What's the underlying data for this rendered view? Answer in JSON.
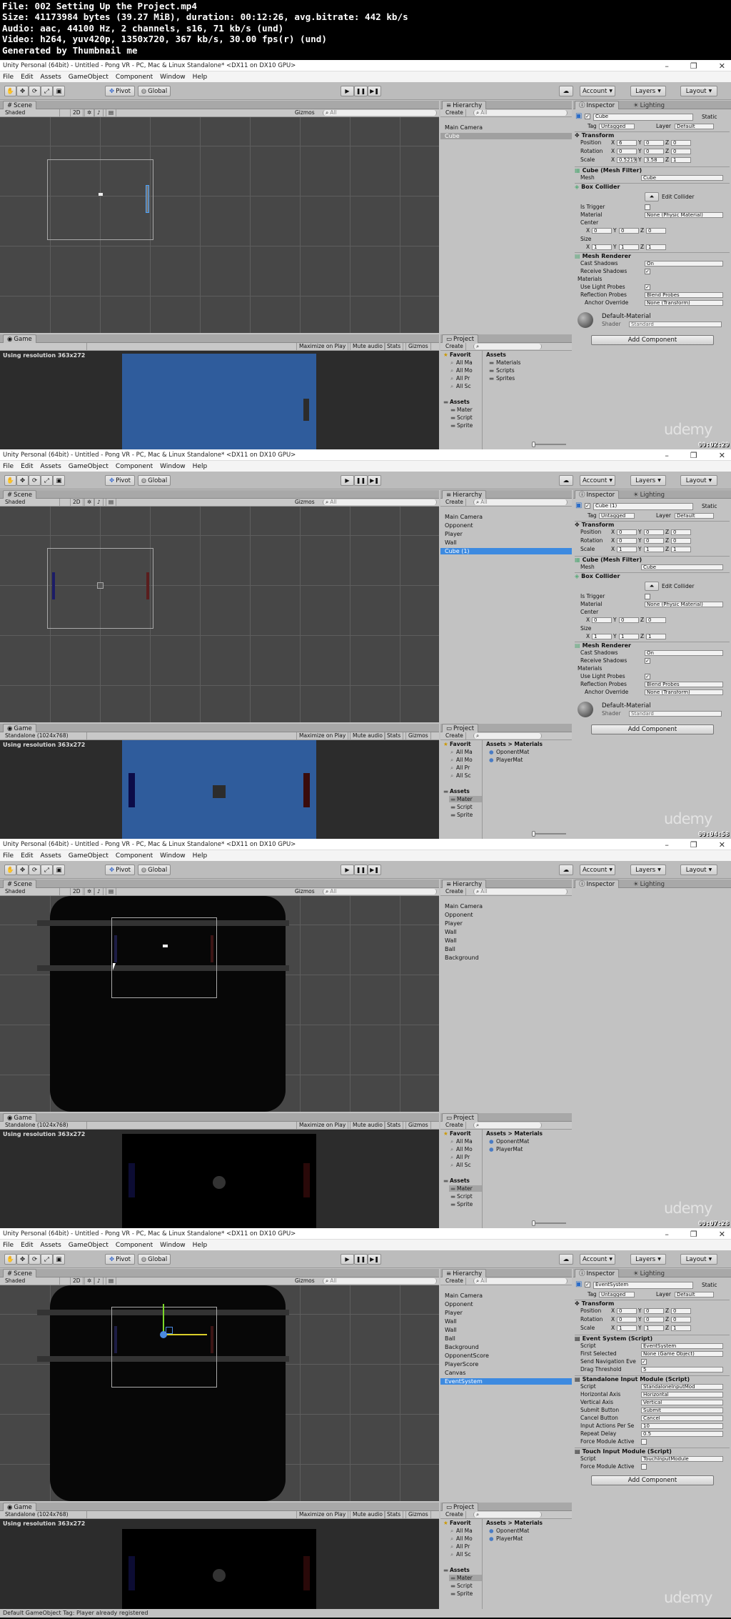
{
  "info": {
    "lines": [
      "File: 002 Setting Up the Project.mp4",
      "Size: 41173984 bytes (39.27 MiB), duration: 00:12:26, avg.bitrate: 442 kb/s",
      "Audio: aac, 44100 Hz, 2 channels, s16, 71 kb/s (und)",
      "Video: h264, yuv420p, 1350x720, 367 kb/s, 30.00 fps(r) (und)",
      "Generated by Thumbnail me"
    ]
  },
  "common": {
    "window_title": "Unity Personal (64bit) - Untitled - Pong VR - PC, Mac & Linux Standalone* <DX11 on DX10 GPU>",
    "menu": [
      "File",
      "Edit",
      "Assets",
      "GameObject",
      "Component",
      "Window",
      "Help"
    ],
    "toolbar": {
      "pivot": "Pivot",
      "global": "Global",
      "account": "Account",
      "layers": "Layers",
      "layout": "Layout"
    },
    "scene_tab": "Scene",
    "game_tab": "Game",
    "shaded": "Shaded",
    "mode_2d": "2D",
    "gizmos": "Gizmos",
    "search_all": "All",
    "maximize": "Maximize on Play",
    "mute": "Mute audio",
    "stats": "Stats",
    "hierarchy_tab": "Hierarchy",
    "create": "Create",
    "project_tab": "Project",
    "inspector_tab": "Inspector",
    "lighting_tab": "Lighting",
    "resolution_text": "Using resolution 363x272",
    "favorites": "Favorit",
    "fav_items": [
      "All Ma",
      "All Mo",
      "All Pr",
      "All Sc"
    ],
    "assets_label": "Assets",
    "asset_folders": [
      "Mater",
      "Script",
      "Sprite"
    ],
    "add_component": "Add Component",
    "watermark": "udemy",
    "static": "Static",
    "tag_label": "Tag",
    "tag_value": "Untagged",
    "layer_label": "Layer",
    "layer_value": "Default"
  },
  "frames": [
    {
      "timestamp": "00:02:29",
      "game_aspect": "",
      "hierarchy": [
        "Main Camera",
        "Cube"
      ],
      "hierarchy_selected": 1,
      "hierarchy_selected_style": "grey",
      "project_path": "Assets",
      "project_items": [
        "Materials",
        "Scripts",
        "Sprites"
      ],
      "inspector": {
        "object_name": "Cube",
        "show_lighting": true,
        "transform": {
          "pos": [
            "6",
            "0",
            "0"
          ],
          "rot": [
            "0",
            "0",
            "0"
          ],
          "scale": [
            "0.52192",
            "3.58",
            "1"
          ]
        },
        "mesh_filter_title": "Cube (Mesh Filter)",
        "mesh": "Cube",
        "box_collider": "Box Collider",
        "edit_collider": "Edit Collider",
        "is_trigger": "Is Trigger",
        "material_label": "Material",
        "material_value": "None (Physic Material)",
        "center_label": "Center",
        "center": [
          "0",
          "0",
          "0"
        ],
        "size_label": "Size",
        "size": [
          "1",
          "1",
          "1"
        ],
        "mesh_renderer": "Mesh Renderer",
        "cast_shadows": "Cast Shadows",
        "cast_value": "On",
        "receive_shadows": "Receive Shadows",
        "materials": "Materials",
        "light_probes": "Use Light Probes",
        "reflection_probes": "Reflection Probes",
        "reflection_value": "Blend Probes",
        "anchor_override": "Anchor Override",
        "anchor_value": "None (Transform)",
        "default_material": "Default-Material",
        "shader_label": "Shader",
        "shader_value": "Standard"
      }
    },
    {
      "timestamp": "00:04:58",
      "game_aspect": "Standalone (1024x768)",
      "hierarchy": [
        "Main Camera",
        "Opponent",
        "Player",
        "Wall",
        "Cube (1)"
      ],
      "hierarchy_selected": 4,
      "hierarchy_selected_style": "blue",
      "project_path": "Assets > Materials",
      "project_items": [
        "OponentMat",
        "PlayerMat"
      ],
      "inspector": {
        "object_name": "Cube (1)",
        "show_lighting": true,
        "transform": {
          "pos": [
            "0",
            "0",
            "0"
          ],
          "rot": [
            "0",
            "0",
            "0"
          ],
          "scale": [
            "1",
            "1",
            "1"
          ]
        },
        "mesh_filter_title": "Cube (Mesh Filter)",
        "mesh": "Cube",
        "box_collider": "Box Collider",
        "edit_collider": "Edit Collider",
        "is_trigger": "Is Trigger",
        "material_label": "Material",
        "material_value": "None (Physic Material)",
        "center_label": "Center",
        "center": [
          "0",
          "0",
          "0"
        ],
        "size_label": "Size",
        "size": [
          "1",
          "1",
          "1"
        ],
        "mesh_renderer": "Mesh Renderer",
        "cast_shadows": "Cast Shadows",
        "cast_value": "On",
        "receive_shadows": "Receive Shadows",
        "materials": "Materials",
        "light_probes": "Use Light Probes",
        "reflection_probes": "Reflection Probes",
        "reflection_value": "Blend Probes",
        "anchor_override": "Anchor Override",
        "anchor_value": "None (Transform)",
        "default_material": "Default-Material",
        "shader_label": "Shader",
        "shader_value": "Standard"
      }
    },
    {
      "timestamp": "00:07:28",
      "game_aspect": "Standalone (1024x768)",
      "hierarchy": [
        "Main Camera",
        "Opponent",
        "Player",
        "Wall",
        "Wall",
        "Ball",
        "Background"
      ],
      "hierarchy_selected": -1,
      "project_path": "Assets > Materials",
      "project_items": [
        "OponentMat",
        "PlayerMat"
      ]
    },
    {
      "timestamp": "00:09:57",
      "game_aspect": "Standalone (1024x768)",
      "hierarchy": [
        "Main Camera",
        "Opponent",
        "Player",
        "Wall",
        "Wall",
        "Ball",
        "Background",
        "OpponentScore",
        "PlayerScore",
        "Canvas",
        "EventSystem"
      ],
      "hierarchy_selected": 10,
      "hierarchy_selected_style": "blue",
      "project_path": "Assets > Materials",
      "project_items": [
        "OponentMat",
        "PlayerMat"
      ],
      "status_text": "Default GameObject Tag: Player already registered",
      "inspector": {
        "object_name": "EventSystem",
        "transform": {
          "pos": [
            "0",
            "0",
            "0"
          ],
          "rot": [
            "0",
            "0",
            "0"
          ],
          "scale": [
            "1",
            "1",
            "1"
          ]
        },
        "es_title": "Event System (Script)",
        "script_label": "Script",
        "es_script": "EventSystem",
        "first_selected": "First Selected",
        "first_selected_value": "None (Game Object)",
        "send_nav": "Send Navigation Eve",
        "drag_threshold": "Drag Threshold",
        "drag_value": "5",
        "sim_title": "Standalone Input Module (Script)",
        "sim_script": "StandaloneInputMod",
        "rows": [
          {
            "label": "Horizontal Axis",
            "value": "Horizontal"
          },
          {
            "label": "Vertical Axis",
            "value": "Vertical"
          },
          {
            "label": "Submit Button",
            "value": "Submit"
          },
          {
            "label": "Cancel Button",
            "value": "Cancel"
          },
          {
            "label": "Input Actions Per Se",
            "value": "10"
          },
          {
            "label": "Repeat Delay",
            "value": "0.5"
          }
        ],
        "force_module": "Force Module Active",
        "tim_title": "Touch Input Module (Script)",
        "tim_script": "TouchInputModule"
      }
    }
  ]
}
